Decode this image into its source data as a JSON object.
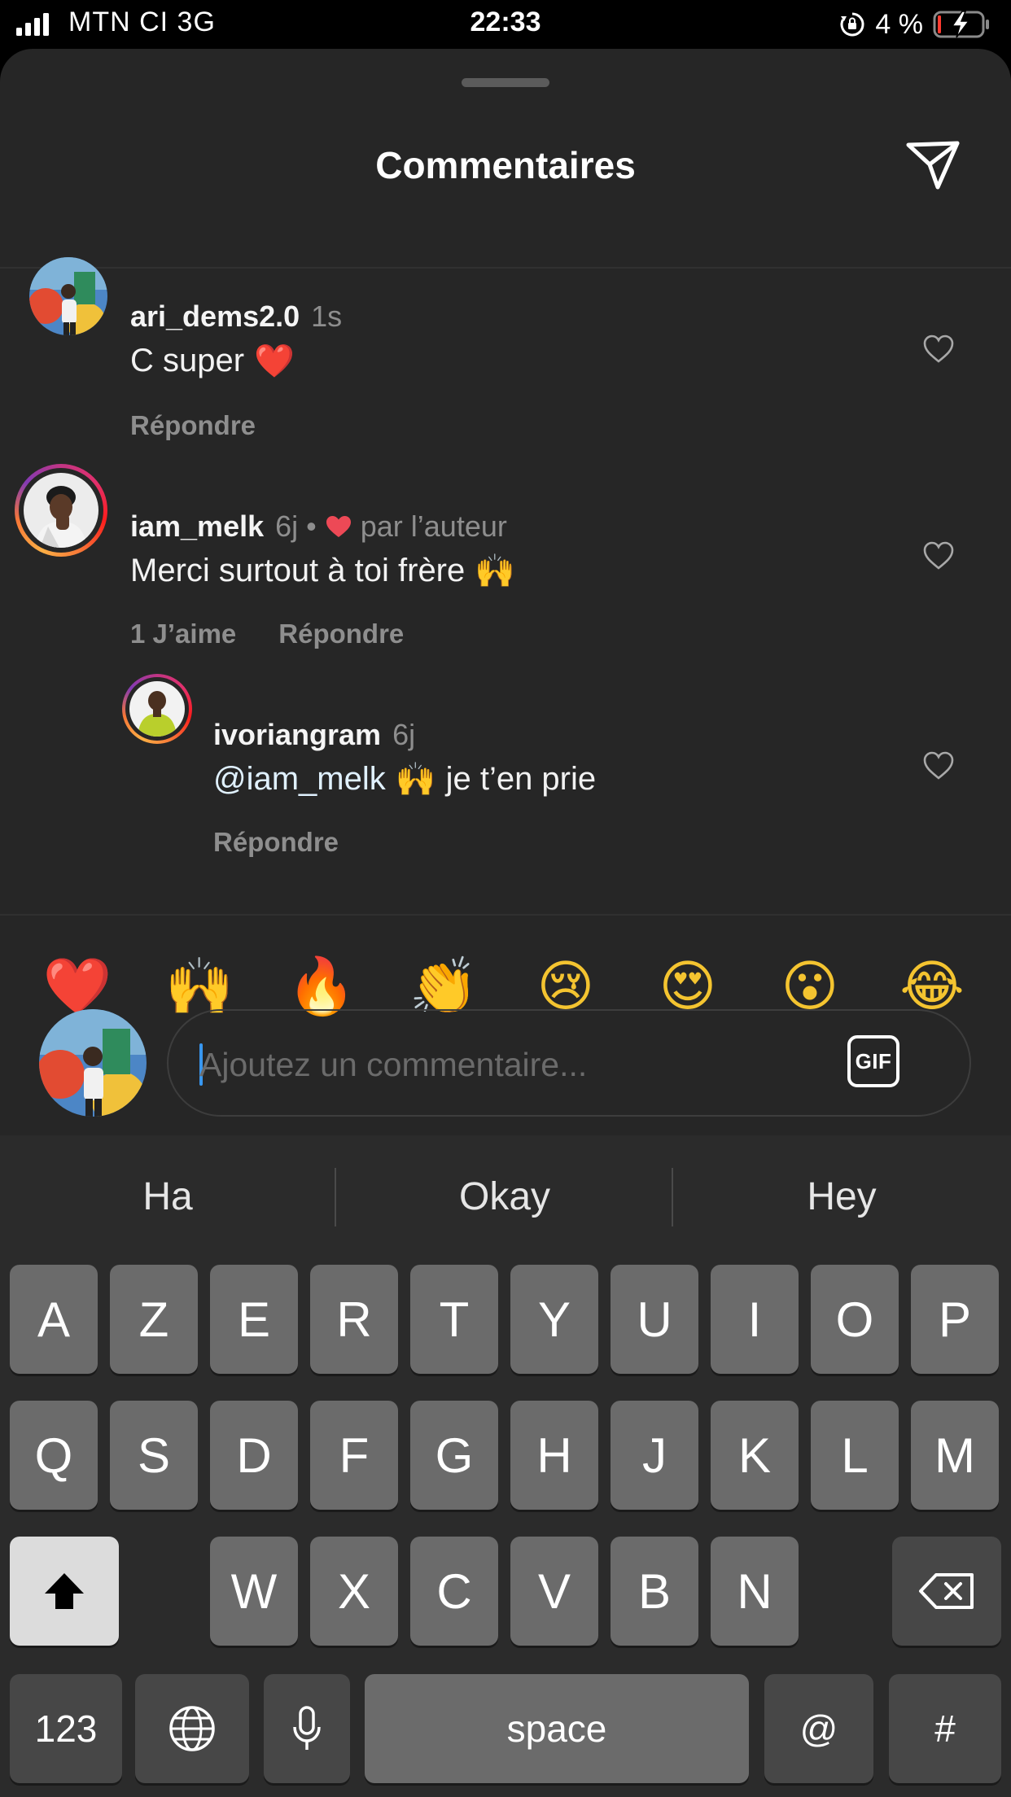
{
  "status_bar": {
    "carrier": "MTN CI  3G",
    "time": "22:33",
    "battery": "4 %"
  },
  "header": {
    "title": "Commentaires",
    "share_icon": "send-icon"
  },
  "comments": [
    {
      "username": "ari_dems2.0",
      "time": "1s",
      "text": "C super",
      "emoji": "❤️",
      "reply_label": "Répondre"
    },
    {
      "username": "iam_melk",
      "time": "6j",
      "separator": "•",
      "liked_by_author": "par l’auteur",
      "text": "Merci surtout à toi frère",
      "emoji": "🙌",
      "likes_label": "1 J’aime",
      "reply_label": "Répondre"
    },
    {
      "username": "ivoriangram",
      "time": "6j",
      "mention": "@iam_melk",
      "emoji": "🙌",
      "text": "je t’en prie",
      "reply_label": "Répondre"
    }
  ],
  "reactions": [
    "❤️",
    "🙌",
    "🔥",
    "👏",
    "😢",
    "😍",
    "😮",
    "😂"
  ],
  "composer": {
    "placeholder": "Ajoutez un commentaire...",
    "gif_label": "GIF"
  },
  "keyboard": {
    "predictions": [
      "Ha",
      "Okay",
      "Hey"
    ],
    "row1": [
      "A",
      "Z",
      "E",
      "R",
      "T",
      "Y",
      "U",
      "I",
      "O",
      "P"
    ],
    "row2": [
      "Q",
      "S",
      "D",
      "F",
      "G",
      "H",
      "J",
      "K",
      "L",
      "M"
    ],
    "row3": [
      "W",
      "X",
      "C",
      "V",
      "B",
      "N"
    ],
    "numbers_label": "123",
    "space_label": "space",
    "at_label": "@",
    "hash_label": "#"
  },
  "colors": {
    "sheet_background": "#262626",
    "muted_text": "#8e8e8e",
    "accent_caret": "#3897f0",
    "like_red": "#ed4956"
  }
}
